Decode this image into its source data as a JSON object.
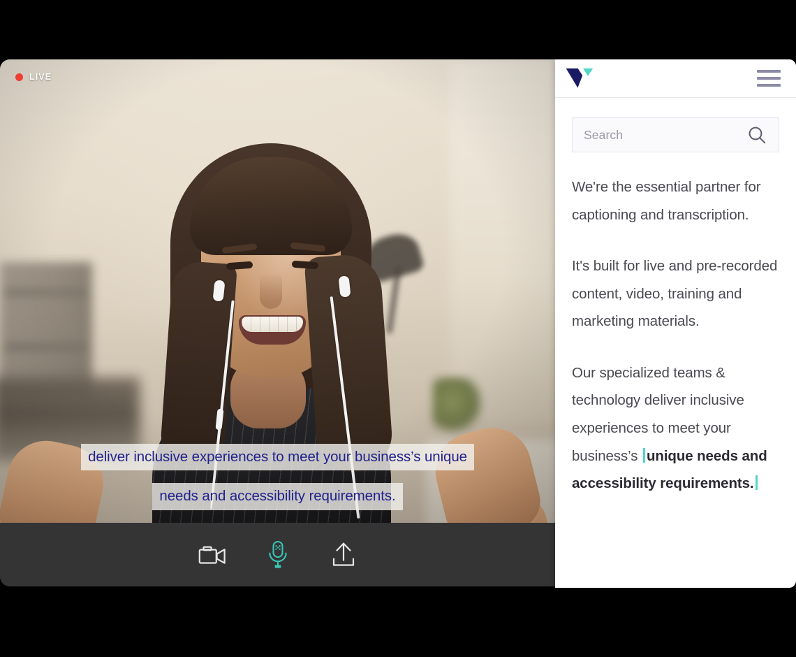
{
  "video": {
    "live_badge": {
      "label": "LIVE",
      "dot_color": "#f03c32"
    },
    "captions": [
      "deliver inclusive experiences to meet your business’s unique",
      "needs and accessibility requirements."
    ],
    "caption_text_color": "#22228e",
    "caption_bg_color": "rgba(243,241,238,0.80)",
    "controls": [
      {
        "name": "video-camera",
        "label": "Camera",
        "state": "on",
        "color": "#e8e8e8"
      },
      {
        "name": "microphone",
        "label": "Microphone",
        "state": "active",
        "color": "#38c6b4"
      },
      {
        "name": "share-upload",
        "label": "Share",
        "state": "on",
        "color": "#e8e8e8"
      }
    ],
    "control_bar_color": "#343434"
  },
  "panel": {
    "logo": {
      "name": "verbit-v-logo",
      "navy": "#1a1a64",
      "teal": "#4fd8c8"
    },
    "menu_icon": {
      "name": "hamburger-menu",
      "color": "#8b8ba6"
    },
    "search": {
      "placeholder": "Search",
      "value": "",
      "icon": "search-icon"
    },
    "paragraphs": [
      {
        "text": "We're the essential partner for captioning and transcription."
      },
      {
        "text": "It's built for live and pre-recorded content, video, training and marketing materials."
      }
    ],
    "live_paragraph": {
      "plain_prefix": "Our specialized teams & technology deliver inclusive experiences to meet your business’s ",
      "bold_text": "unique needs and accessibility requirements.",
      "caret_color": "#4fd8c8"
    }
  }
}
